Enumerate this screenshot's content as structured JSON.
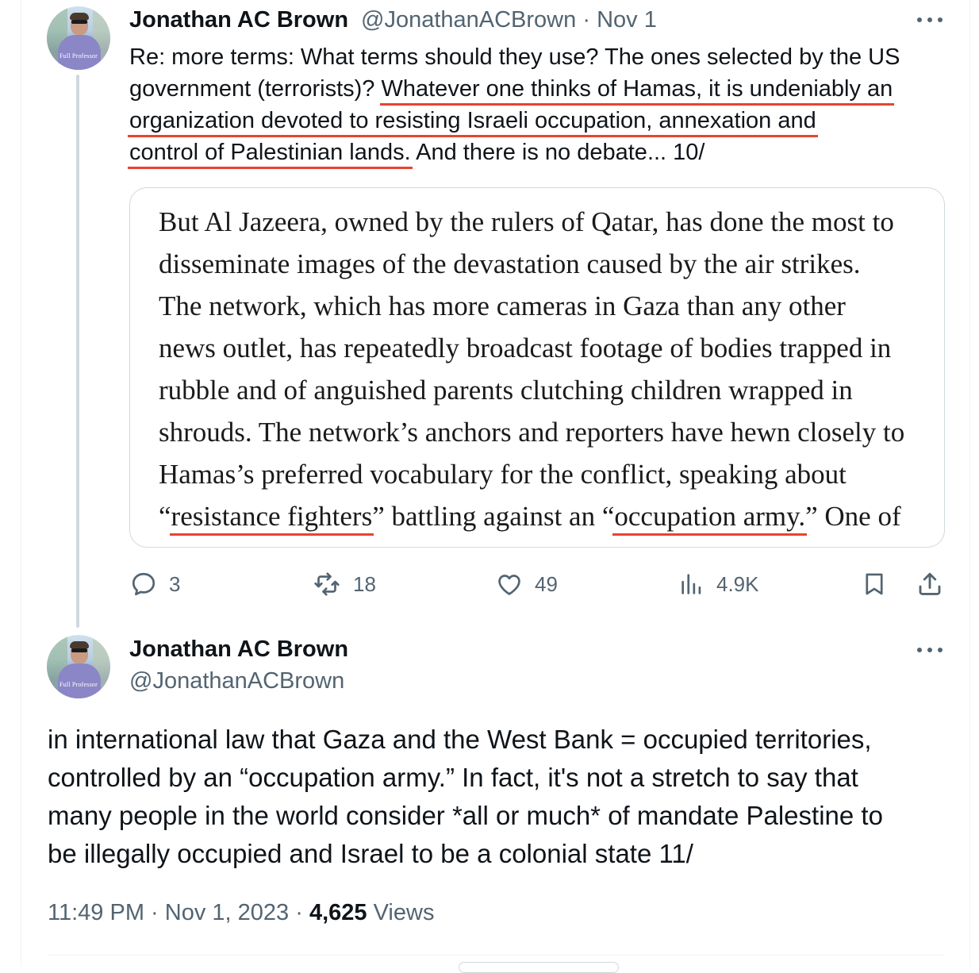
{
  "tweet1": {
    "author_name": "Jonathan AC Brown",
    "handle": "@JonathanACBrown",
    "separator": "·",
    "date": "Nov 1",
    "avatar_caption": "Full Professor",
    "text_lines": [
      {
        "a": "Re: more terms: What terms should they use? The ones selected by the US",
        "u": "",
        "b": ""
      },
      {
        "a": "government (terrorists)? ",
        "u": "Whatever one thinks of Hamas, it is undeniably an",
        "b": ""
      },
      {
        "a": "",
        "u": "organization devoted to resisting Israeli occupation, annexation and",
        "b": ""
      },
      {
        "a": "",
        "u": "control of Palestinian lands.",
        "b": " And there is no debate... 10/"
      }
    ],
    "quote_lines": [
      {
        "a": "But Al Jazeera, owned by the rulers of Qatar, has done the most to",
        "u1": "",
        "m": "",
        "u2": "",
        "b": ""
      },
      {
        "a": "disseminate images of the devastation caused by the air strikes.",
        "u1": "",
        "m": "",
        "u2": "",
        "b": ""
      },
      {
        "a": "The network, which has more cameras in Gaza than any other",
        "u1": "",
        "m": "",
        "u2": "",
        "b": ""
      },
      {
        "a": "news outlet, has repeatedly broadcast footage of bodies trapped in",
        "u1": "",
        "m": "",
        "u2": "",
        "b": ""
      },
      {
        "a": "rubble and of anguished parents clutching children wrapped in",
        "u1": "",
        "m": "",
        "u2": "",
        "b": ""
      },
      {
        "a": "shrouds. The network’s anchors and reporters have hewn closely to",
        "u1": "",
        "m": "",
        "u2": "",
        "b": ""
      },
      {
        "a": "Hamas’s preferred vocabulary for the conflict, speaking about",
        "u1": "",
        "m": "",
        "u2": "",
        "b": ""
      },
      {
        "a": "“",
        "u1": "resistance fighters",
        "m": "” battling against an “",
        "u2": "occupation army.",
        "b": "” One of"
      }
    ],
    "actions": {
      "replies": "3",
      "reposts": "18",
      "likes": "49",
      "views": "4.9K"
    }
  },
  "tweet2": {
    "author_name": "Jonathan AC Brown",
    "handle": "@JonathanACBrown",
    "avatar_caption": "Full Professor",
    "text_lines": [
      "in international law that Gaza and the West Bank = occupied territories,",
      "controlled by an “occupation army.” In fact, it's not a stretch to say that",
      "many people in the world consider *all or much* of mandate Palestine to",
      "be illegally occupied and Israel to be a colonial state 11/"
    ],
    "time": "11:49 PM",
    "separator": "·",
    "date": "Nov 1, 2023",
    "view_count": "4,625",
    "views_label": "Views"
  },
  "colors": {
    "underline": "#e8432f",
    "secondary_text": "#536471",
    "primary_text": "#0f1419",
    "thread_line": "#cfd9de"
  },
  "icons": [
    "more-icon",
    "reply-icon",
    "repost-icon",
    "like-icon",
    "views-icon",
    "bookmark-icon",
    "share-icon"
  ]
}
